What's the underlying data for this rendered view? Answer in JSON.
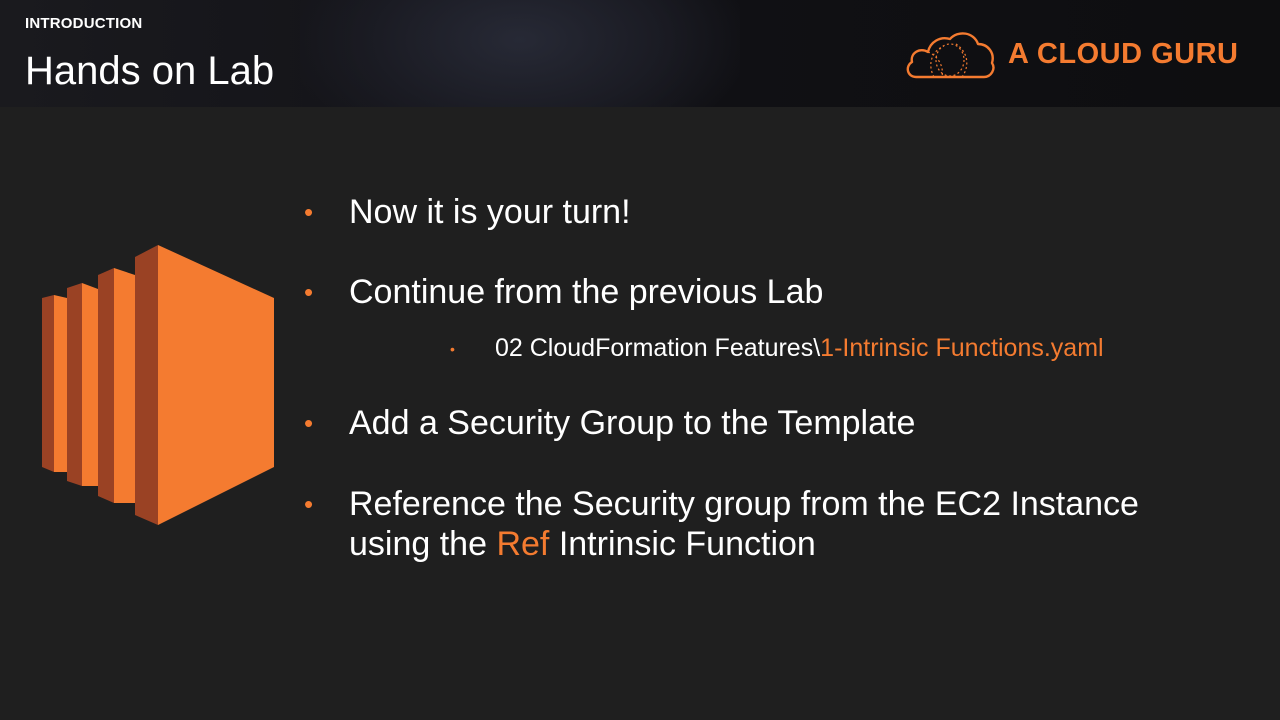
{
  "header": {
    "section": "INTRODUCTION",
    "title": "Hands on Lab",
    "brand_name": "A CLOUD GURU",
    "brand_color": "#f47b30"
  },
  "illustration": {
    "icon": "ec2-instances-icon",
    "color": "#f47b30"
  },
  "bullets": [
    {
      "text": "Now it is your turn!"
    },
    {
      "text": "Continue from the previous Lab"
    },
    {
      "prefix": "02 CloudFormation Features\\",
      "highlight": "1-Intrinsic Functions.yaml"
    },
    {
      "text": "Add a Security Group to the Template"
    },
    {
      "line1": "Reference the Security group from the EC2 Instance",
      "line2_before": "using the ",
      "line2_highlight": "Ref",
      "line2_after": " Intrinsic Function"
    }
  ],
  "bullet_glyph": "•"
}
